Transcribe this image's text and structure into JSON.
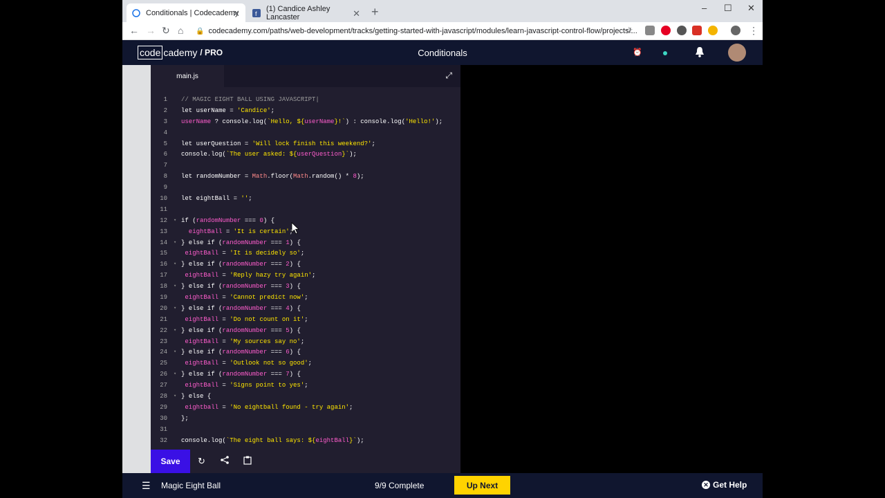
{
  "browser": {
    "tabs": [
      {
        "label": "Conditionals | Codecademy",
        "active": true,
        "icon": "codecademy-favicon"
      },
      {
        "label": "(1) Candice Ashley Lancaster",
        "active": false,
        "icon": "facebook-favicon"
      }
    ],
    "url": "codecademy.com/paths/web-development/tracks/getting-started-with-javascript/modules/learn-javascript-control-flow/projects/...",
    "window_controls": {
      "minimize": "–",
      "maximize": "☐",
      "close": "✕"
    }
  },
  "header": {
    "logo_boxed": "code",
    "logo_rest": "cademy",
    "logo_pro": "/ PRO",
    "lesson_title": "Conditionals"
  },
  "editor": {
    "file_tab": "main.js",
    "lines": [
      {
        "n": "1",
        "fold": "",
        "segs": [
          {
            "t": "// MAGIC EIGHT BALL USING JAVASCRIPT|",
            "c": "cmt"
          }
        ]
      },
      {
        "n": "2",
        "fold": "",
        "segs": [
          {
            "t": "let ",
            "c": "kw"
          },
          {
            "t": "userName",
            "c": "kw"
          },
          {
            "t": " = ",
            "c": "kw"
          },
          {
            "t": "'Candice'",
            "c": "str"
          },
          {
            "t": ";",
            "c": "kw"
          }
        ]
      },
      {
        "n": "3",
        "fold": "",
        "segs": [
          {
            "t": "userName",
            "c": "var"
          },
          {
            "t": " ? ",
            "c": "kw"
          },
          {
            "t": "console.log(",
            "c": "kw"
          },
          {
            "t": "`Hello, ${",
            "c": "str"
          },
          {
            "t": "userName",
            "c": "var"
          },
          {
            "t": "}!`",
            "c": "str"
          },
          {
            "t": ") : ",
            "c": "kw"
          },
          {
            "t": "console.log(",
            "c": "kw"
          },
          {
            "t": "'Hello!'",
            "c": "str"
          },
          {
            "t": ");",
            "c": "kw"
          }
        ]
      },
      {
        "n": "4",
        "fold": "",
        "segs": []
      },
      {
        "n": "5",
        "fold": "",
        "segs": [
          {
            "t": "let ",
            "c": "kw"
          },
          {
            "t": "userQuestion",
            "c": "kw"
          },
          {
            "t": " = ",
            "c": "kw"
          },
          {
            "t": "'Will lock finish this weekend?'",
            "c": "str"
          },
          {
            "t": ";",
            "c": "kw"
          }
        ]
      },
      {
        "n": "6",
        "fold": "",
        "segs": [
          {
            "t": "console.log(",
            "c": "kw"
          },
          {
            "t": "`The user asked: ${",
            "c": "str"
          },
          {
            "t": "userQuestion",
            "c": "var"
          },
          {
            "t": "}`",
            "c": "str"
          },
          {
            "t": ");",
            "c": "kw"
          }
        ]
      },
      {
        "n": "7",
        "fold": "",
        "segs": []
      },
      {
        "n": "8",
        "fold": "",
        "segs": [
          {
            "t": "let ",
            "c": "kw"
          },
          {
            "t": "randomNumber",
            "c": "kw"
          },
          {
            "t": " = ",
            "c": "kw"
          },
          {
            "t": "Math",
            "c": "obj"
          },
          {
            "t": ".floor(",
            "c": "kw"
          },
          {
            "t": "Math",
            "c": "obj"
          },
          {
            "t": ".random() * ",
            "c": "kw"
          },
          {
            "t": "8",
            "c": "var"
          },
          {
            "t": ");",
            "c": "kw"
          }
        ]
      },
      {
        "n": "9",
        "fold": "",
        "segs": []
      },
      {
        "n": "10",
        "fold": "",
        "segs": [
          {
            "t": "let ",
            "c": "kw"
          },
          {
            "t": "eightBall",
            "c": "kw"
          },
          {
            "t": " = ",
            "c": "kw"
          },
          {
            "t": "''",
            "c": "str"
          },
          {
            "t": ";",
            "c": "kw"
          }
        ]
      },
      {
        "n": "11",
        "fold": "",
        "segs": []
      },
      {
        "n": "12",
        "fold": "▾",
        "segs": [
          {
            "t": "if (",
            "c": "kw"
          },
          {
            "t": "randomNumber",
            "c": "var"
          },
          {
            "t": " === ",
            "c": "kw"
          },
          {
            "t": "0",
            "c": "var"
          },
          {
            "t": ") {",
            "c": "kw"
          }
        ]
      },
      {
        "n": "13",
        "fold": "",
        "segs": [
          {
            "t": "  eightBall",
            "c": "var"
          },
          {
            "t": " = ",
            "c": "kw"
          },
          {
            "t": "'It is certain'",
            "c": "str"
          },
          {
            "t": ";",
            "c": "kw"
          }
        ]
      },
      {
        "n": "14",
        "fold": "▾",
        "segs": [
          {
            "t": "} else if (",
            "c": "kw"
          },
          {
            "t": "randomNumber",
            "c": "var"
          },
          {
            "t": " === ",
            "c": "kw"
          },
          {
            "t": "1",
            "c": "var"
          },
          {
            "t": ") {",
            "c": "kw"
          }
        ]
      },
      {
        "n": "15",
        "fold": "",
        "segs": [
          {
            "t": " eightBall",
            "c": "var"
          },
          {
            "t": " = ",
            "c": "kw"
          },
          {
            "t": "'It is decidely so'",
            "c": "str"
          },
          {
            "t": ";",
            "c": "kw"
          }
        ]
      },
      {
        "n": "16",
        "fold": "▾",
        "segs": [
          {
            "t": "} else if (",
            "c": "kw"
          },
          {
            "t": "randomNumber",
            "c": "var"
          },
          {
            "t": " === ",
            "c": "kw"
          },
          {
            "t": "2",
            "c": "var"
          },
          {
            "t": ") {",
            "c": "kw"
          }
        ]
      },
      {
        "n": "17",
        "fold": "",
        "segs": [
          {
            "t": " eightBall",
            "c": "var"
          },
          {
            "t": " = ",
            "c": "kw"
          },
          {
            "t": "'Reply hazy try again'",
            "c": "str"
          },
          {
            "t": ";",
            "c": "kw"
          }
        ]
      },
      {
        "n": "18",
        "fold": "▾",
        "segs": [
          {
            "t": "} else if (",
            "c": "kw"
          },
          {
            "t": "randomNumber",
            "c": "var"
          },
          {
            "t": " === ",
            "c": "kw"
          },
          {
            "t": "3",
            "c": "var"
          },
          {
            "t": ") {",
            "c": "kw"
          }
        ]
      },
      {
        "n": "19",
        "fold": "",
        "segs": [
          {
            "t": " eightBall",
            "c": "var"
          },
          {
            "t": " = ",
            "c": "kw"
          },
          {
            "t": "'Cannot predict now'",
            "c": "str"
          },
          {
            "t": ";",
            "c": "kw"
          }
        ]
      },
      {
        "n": "20",
        "fold": "▾",
        "segs": [
          {
            "t": "} else if (",
            "c": "kw"
          },
          {
            "t": "randomNumber",
            "c": "var"
          },
          {
            "t": " === ",
            "c": "kw"
          },
          {
            "t": "4",
            "c": "var"
          },
          {
            "t": ") {",
            "c": "kw"
          }
        ]
      },
      {
        "n": "21",
        "fold": "",
        "segs": [
          {
            "t": " eightBall",
            "c": "var"
          },
          {
            "t": " = ",
            "c": "kw"
          },
          {
            "t": "'Do not count on it'",
            "c": "str"
          },
          {
            "t": ";",
            "c": "kw"
          }
        ]
      },
      {
        "n": "22",
        "fold": "▾",
        "segs": [
          {
            "t": "} else if (",
            "c": "kw"
          },
          {
            "t": "randomNumber",
            "c": "var"
          },
          {
            "t": " === ",
            "c": "kw"
          },
          {
            "t": "5",
            "c": "var"
          },
          {
            "t": ") {",
            "c": "kw"
          }
        ]
      },
      {
        "n": "23",
        "fold": "",
        "segs": [
          {
            "t": " eightBall",
            "c": "var"
          },
          {
            "t": " = ",
            "c": "kw"
          },
          {
            "t": "'My sources say no'",
            "c": "str"
          },
          {
            "t": ";",
            "c": "kw"
          }
        ]
      },
      {
        "n": "24",
        "fold": "▾",
        "segs": [
          {
            "t": "} else if (",
            "c": "kw"
          },
          {
            "t": "randomNumber",
            "c": "var"
          },
          {
            "t": " === ",
            "c": "kw"
          },
          {
            "t": "6",
            "c": "var"
          },
          {
            "t": ") {",
            "c": "kw"
          }
        ]
      },
      {
        "n": "25",
        "fold": "",
        "segs": [
          {
            "t": " eightBall",
            "c": "var"
          },
          {
            "t": " = ",
            "c": "kw"
          },
          {
            "t": "'Outlook not so good'",
            "c": "str"
          },
          {
            "t": ";",
            "c": "kw"
          }
        ]
      },
      {
        "n": "26",
        "fold": "▾",
        "segs": [
          {
            "t": "} else if (",
            "c": "kw"
          },
          {
            "t": "randomNumber",
            "c": "var"
          },
          {
            "t": " === ",
            "c": "kw"
          },
          {
            "t": "7",
            "c": "var"
          },
          {
            "t": ") {",
            "c": "kw"
          }
        ]
      },
      {
        "n": "27",
        "fold": "",
        "segs": [
          {
            "t": " eightBall",
            "c": "var"
          },
          {
            "t": " = ",
            "c": "kw"
          },
          {
            "t": "'Signs point to yes'",
            "c": "str"
          },
          {
            "t": ";",
            "c": "kw"
          }
        ]
      },
      {
        "n": "28",
        "fold": "▾",
        "segs": [
          {
            "t": "} else {",
            "c": "kw"
          }
        ]
      },
      {
        "n": "29",
        "fold": "",
        "segs": [
          {
            "t": " eightball",
            "c": "var"
          },
          {
            "t": " = ",
            "c": "kw"
          },
          {
            "t": "'No eightball found - try again'",
            "c": "str"
          },
          {
            "t": ";",
            "c": "kw"
          }
        ]
      },
      {
        "n": "30",
        "fold": "",
        "segs": [
          {
            "t": "};",
            "c": "kw"
          }
        ]
      },
      {
        "n": "31",
        "fold": "",
        "segs": []
      },
      {
        "n": "32",
        "fold": "",
        "segs": [
          {
            "t": "console.log(",
            "c": "kw"
          },
          {
            "t": "`The eight ball says: ${",
            "c": "str"
          },
          {
            "t": "eightBall",
            "c": "var"
          },
          {
            "t": "}`",
            "c": "str"
          },
          {
            "t": ");",
            "c": "kw"
          }
        ]
      }
    ],
    "save_label": "Save"
  },
  "footer": {
    "lesson_name": "Magic Eight Ball",
    "progress": "9/9 Complete",
    "up_next_label": "Up Next",
    "help_label": "Get Help"
  },
  "colors": {
    "header_bg": "#10162f",
    "editor_bg": "#211e2f",
    "save_button": "#3a10e5",
    "up_next_button": "#ffd300"
  }
}
